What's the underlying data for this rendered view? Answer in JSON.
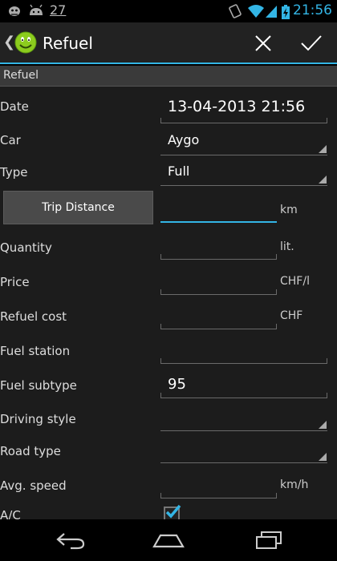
{
  "status_bar": {
    "notification_count": "27",
    "clock": "21:56",
    "accent_color": "#33b5e5"
  },
  "action_bar": {
    "title": "Refuel",
    "icons": [
      "back-chevron-icon",
      "app-logo-smiley-icon",
      "cancel-x-icon",
      "confirm-check-icon"
    ]
  },
  "section": {
    "header": "Refuel"
  },
  "form": {
    "date": {
      "label": "Date",
      "value": "13-04-2013 21:56"
    },
    "car": {
      "label": "Car",
      "value": "Aygo"
    },
    "type": {
      "label": "Type",
      "value": "Full"
    },
    "trip_distance": {
      "button": "Trip Distance",
      "value": "",
      "unit": "km"
    },
    "quantity": {
      "label": "Quantity",
      "value": "",
      "unit": "lit."
    },
    "price": {
      "label": "Price",
      "value": "",
      "unit": "CHF/l"
    },
    "refuel_cost": {
      "label": "Refuel cost",
      "value": "",
      "unit": "CHF"
    },
    "fuel_station": {
      "label": "Fuel station",
      "value": ""
    },
    "fuel_subtype": {
      "label": "Fuel subtype",
      "value": "95"
    },
    "driving_style": {
      "label": "Driving style",
      "value": ""
    },
    "road_type": {
      "label": "Road type",
      "value": ""
    },
    "avg_speed": {
      "label": "Avg. speed",
      "value": "",
      "unit": "km/h"
    },
    "ac": {
      "label": "A/C",
      "checked": true
    }
  },
  "nav_bar": {
    "icons": [
      "back-icon",
      "home-icon",
      "recent-apps-icon"
    ]
  }
}
